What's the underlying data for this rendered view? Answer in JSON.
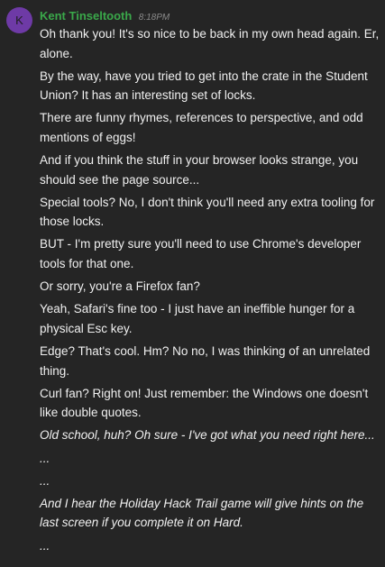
{
  "author": {
    "initial": "K",
    "name": "Kent Tinseltooth",
    "time": "8:18PM"
  },
  "messages": [
    {
      "text": "Oh thank you! It's so nice to be back in my own head again. Er, alone.",
      "italic": false
    },
    {
      "text": "By the way, have you tried to get into the crate in the Student Union? It has an interesting set of locks.",
      "italic": false
    },
    {
      "text": "There are funny rhymes, references to perspective, and odd mentions of eggs!",
      "italic": false
    },
    {
      "text": "And if you think the stuff in your browser looks strange, you should see the page source...",
      "italic": false
    },
    {
      "text": "Special tools? No, I don't think you'll need any extra tooling for those locks.",
      "italic": false
    },
    {
      "text": "BUT - I'm pretty sure you'll need to use Chrome's developer tools for that one.",
      "italic": false
    },
    {
      "text": "Or sorry, you're a Firefox fan?",
      "italic": false
    },
    {
      "text": "Yeah, Safari's fine too - I just have an ineffible hunger for a physical Esc key.",
      "italic": false
    },
    {
      "text": "Edge? That's cool. Hm? No no, I was thinking of an unrelated thing.",
      "italic": false
    },
    {
      "text": "Curl fan? Right on! Just remember: the Windows one doesn't like double quotes.",
      "italic": false
    },
    {
      "text": "Old school, huh? Oh sure - I've got what you need right here...",
      "italic": true
    },
    {
      "text": "...",
      "italic": true
    },
    {
      "text": "...",
      "italic": true
    },
    {
      "text": "And I hear the Holiday Hack Trail game will give hints on the last screen if you complete it on Hard.",
      "italic": true
    },
    {
      "text": "...",
      "italic": true
    }
  ]
}
